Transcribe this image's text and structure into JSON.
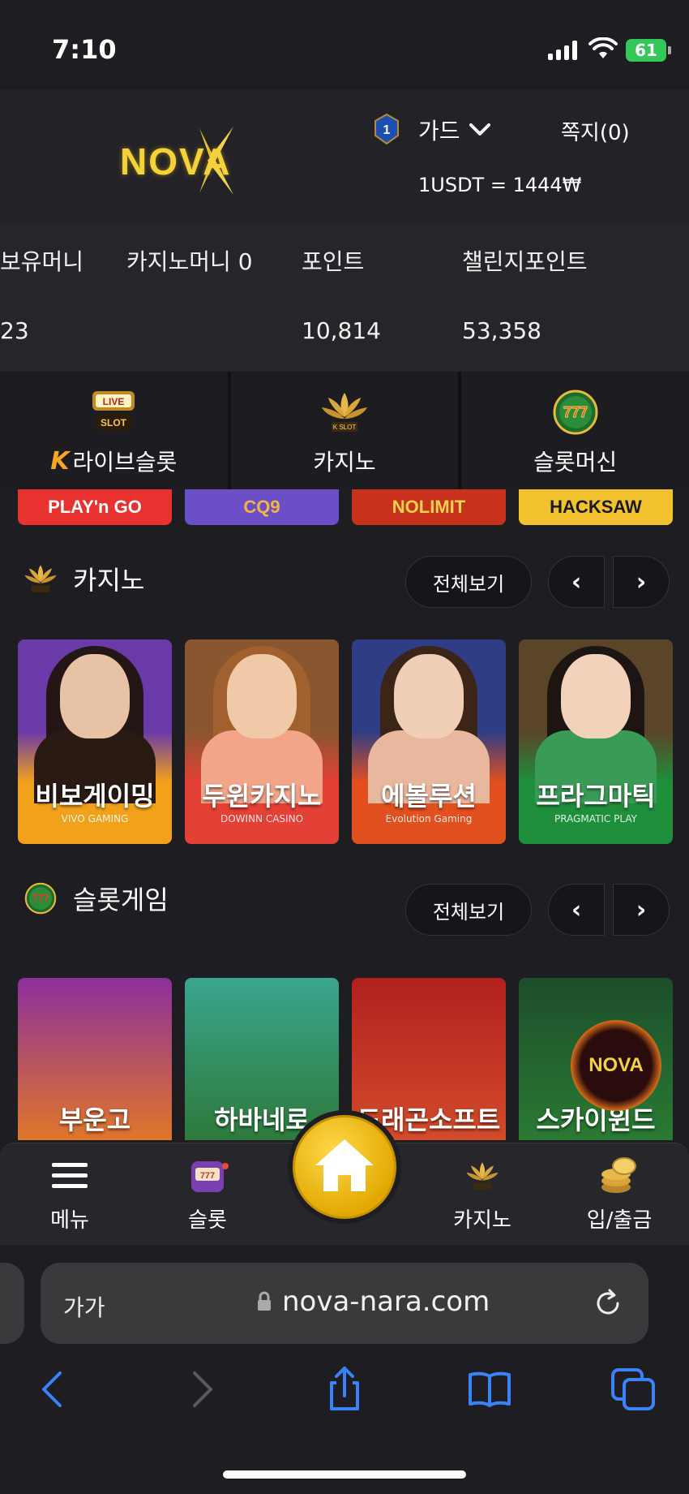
{
  "status": {
    "time": "7:10",
    "battery": "61"
  },
  "header": {
    "logo_text": "NOVA",
    "rank_level": "1",
    "grade": "가드",
    "messages": "쪽지(0)",
    "rate": "1USDT = 1444₩"
  },
  "balance": {
    "items": [
      {
        "label": "보유머니",
        "value": "23"
      },
      {
        "label": "카지노머니 0",
        "value": ""
      },
      {
        "label": "포인트",
        "value": "10,814"
      },
      {
        "label": "챌린지포인트",
        "value": "53,358"
      }
    ]
  },
  "categories": [
    {
      "label": "라이브슬롯",
      "icon": "live-slot-icon",
      "badge_top": "LIVE",
      "badge_bottom": "SLOT"
    },
    {
      "label": "카지노",
      "icon": "k-slot-lotus-icon",
      "badge_bottom": "K SLOT"
    },
    {
      "label": "슬롯머신",
      "icon": "777-slots-icon",
      "badge_bottom": "777"
    }
  ],
  "providers": [
    {
      "name": "PLAY'n GO",
      "bg": "#e8322f",
      "color": "#ffffff"
    },
    {
      "name": "CQ9",
      "bg": "#6a4fc9",
      "color": "#f2b640"
    },
    {
      "name": "NOLIMIT",
      "bg": "#c8321d",
      "color": "#f6d34a"
    },
    {
      "name": "HACKSAW",
      "bg": "#f2c12e",
      "color": "#1a1a1a"
    }
  ],
  "casino_section": {
    "title": "카지노",
    "view_all": "전체보기",
    "prev": "‹",
    "next": "›",
    "cards": [
      {
        "title": "비보게이밍",
        "provider": "VIVO GAMING",
        "bg_top": "#6a3aa8",
        "bg_bottom": "#f2a21a",
        "hair": "#241615",
        "skin": "#e8c2a5",
        "dress": "#2a1a14"
      },
      {
        "title": "두윈카지노",
        "provider": "DOWINN CASINO",
        "bg_top": "#8a5630",
        "bg_bottom": "#e44035",
        "hair": "#a0612f",
        "skin": "#f0c9a8",
        "dress": "#f3a58a"
      },
      {
        "title": "에볼루션",
        "provider": "Evolution Gaming",
        "bg_top": "#2e3d86",
        "bg_bottom": "#e2501f",
        "hair": "#3b2418",
        "skin": "#f1cfb6",
        "dress": "#e9b79d"
      },
      {
        "title": "프라그마틱",
        "provider": "PRAGMATIC PLAY",
        "bg_top": "#5a4528",
        "bg_bottom": "#1f8f3c",
        "hair": "#1c1512",
        "skin": "#f2d2bb",
        "dress": "#3a9b57"
      }
    ]
  },
  "slot_section": {
    "title": "슬롯게임",
    "view_all": "전체보기",
    "prev": "‹",
    "next": "›",
    "cards": [
      {
        "title": "부운고",
        "bg_top": "#8b2f9c",
        "bg_bottom": "#e0762a"
      },
      {
        "title": "하바네로",
        "bg_top": "#3aa58e",
        "bg_bottom": "#2d7a3a"
      },
      {
        "title": "드래곤소프트",
        "bg_top": "#b2201f",
        "bg_bottom": "#d24b2a"
      },
      {
        "title": "스카이윈드",
        "bg_top": "#1d4d2b",
        "bg_bottom": "#2a7a33"
      }
    ]
  },
  "bottom_nav": {
    "menu": "메뉴",
    "slot": "슬롯",
    "casino": "카지노",
    "deposit": "입/출금"
  },
  "safari": {
    "aa": "가가",
    "url": "nova-nara.com"
  }
}
